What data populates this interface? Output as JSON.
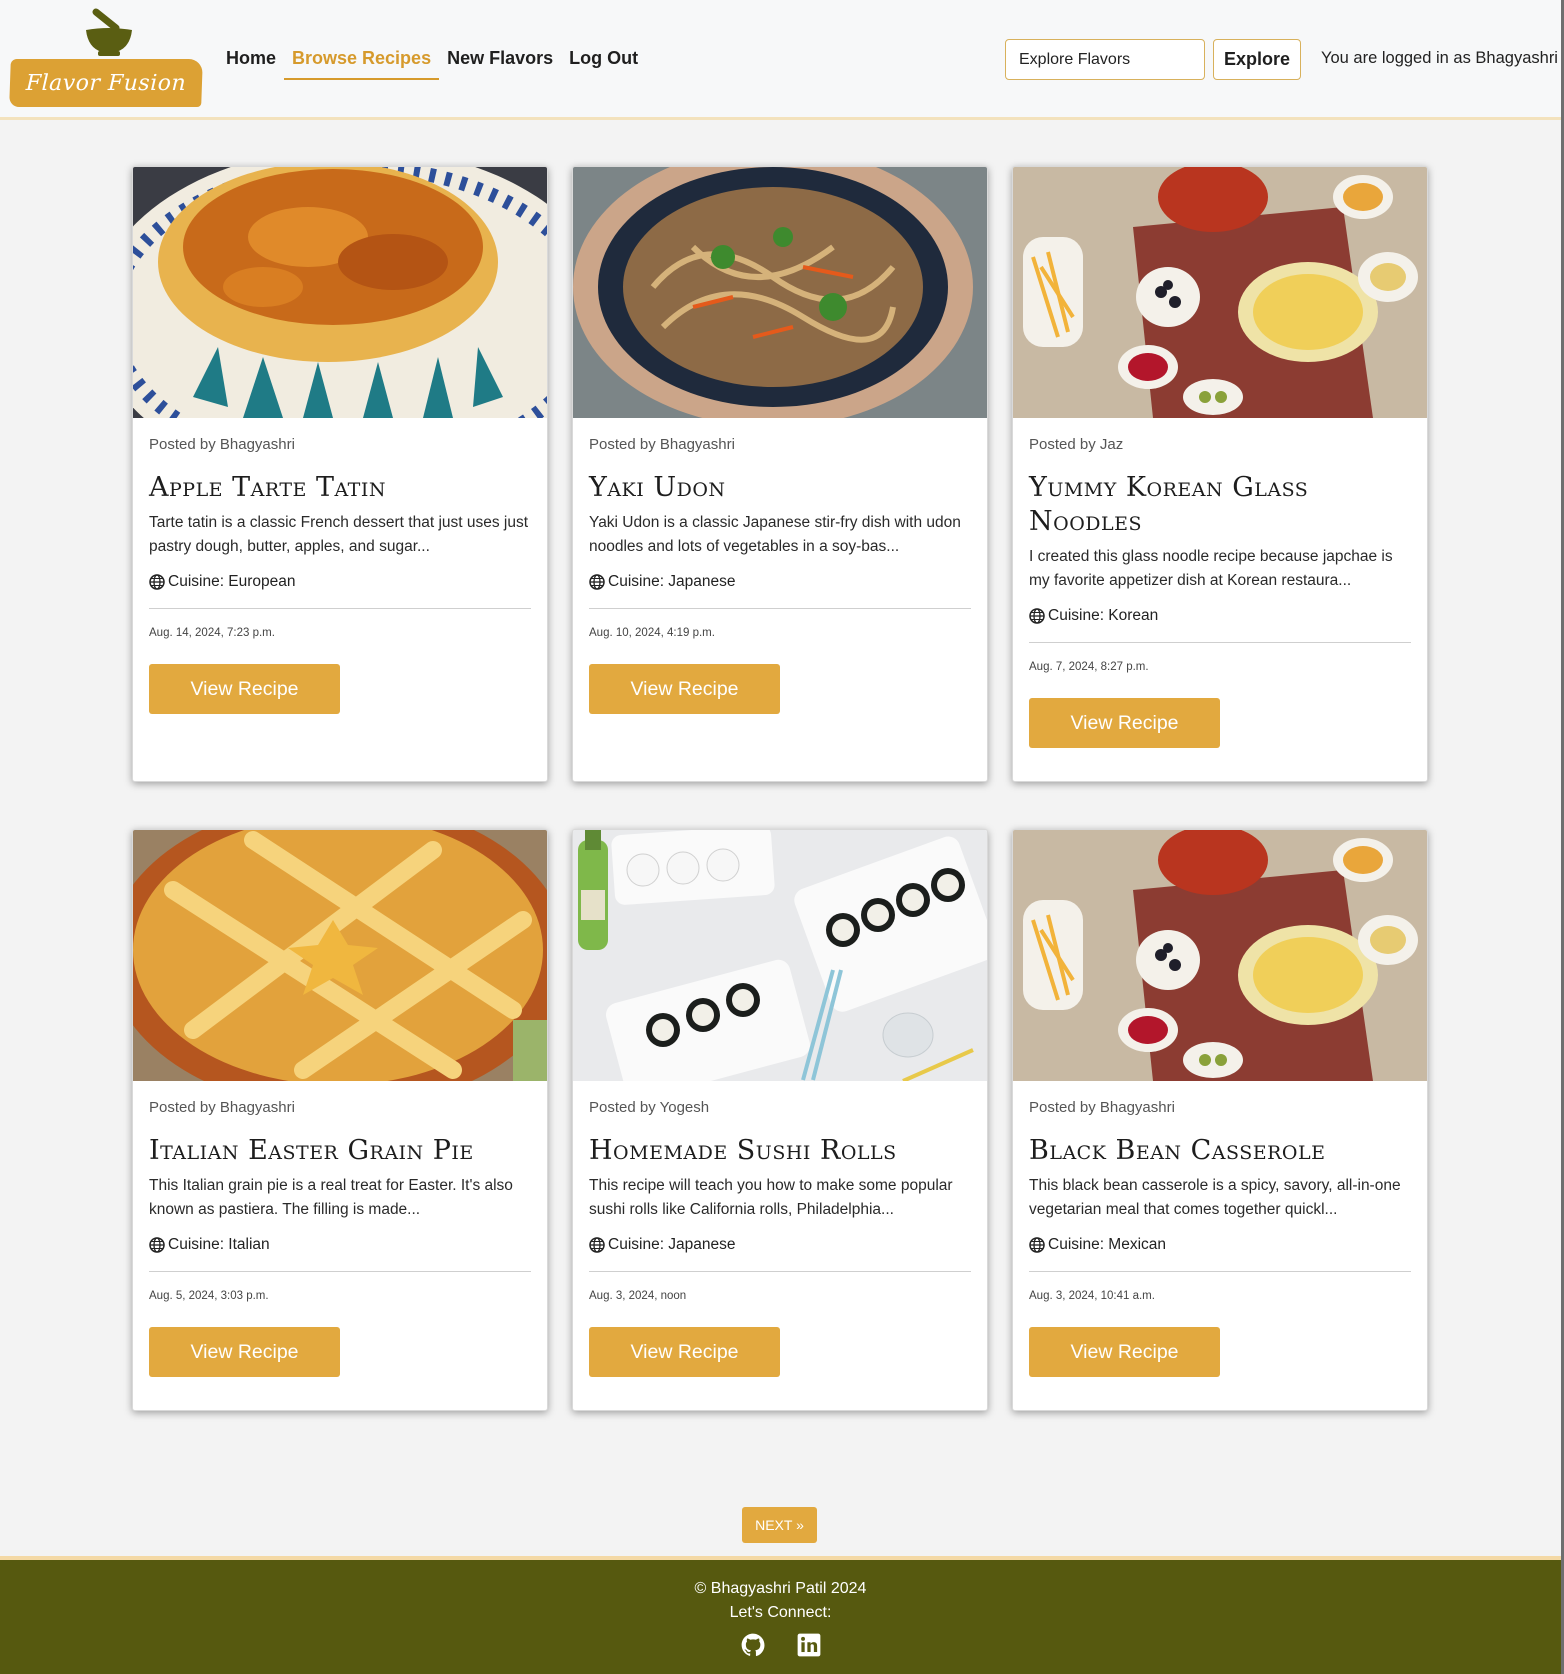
{
  "brand": {
    "name": "Flavor Fusion",
    "primary_color": "#e2a93f",
    "footer_color": "#56590f",
    "logo_icon": "mortar-pestle-icon"
  },
  "nav": {
    "home": "Home",
    "browse": "Browse Recipes",
    "new_flavors": "New Flavors",
    "logout": "Log Out",
    "active": "Browse Recipes"
  },
  "search": {
    "placeholder": "Explore Flavors",
    "button_label": "Explore"
  },
  "user": {
    "login_text": "You are logged in as Bhagyashri"
  },
  "recipes": [
    {
      "author": "Posted by Bhagyashri",
      "title": "Apple Tarte Tatin",
      "description": "Tarte tatin is a classic French dessert that just uses just pastry dough, butter, apples, and sugar...",
      "cuisine": "Cuisine: European",
      "date": "Aug. 14, 2024, 7:23 p.m.",
      "button": "View Recipe"
    },
    {
      "author": "Posted by Bhagyashri",
      "title": "Yaki Udon",
      "description": "Yaki Udon is a classic Japanese stir-fry dish with udon noodles and lots of vegetables in a soy-bas...",
      "cuisine": "Cuisine: Japanese",
      "date": "Aug. 10, 2024, 4:19 p.m.",
      "button": "View Recipe"
    },
    {
      "author": "Posted by Jaz",
      "title": "Yummy Korean Glass Noodles",
      "description": "I created this glass noodle recipe because japchae is my favorite appetizer dish at Korean restaura...",
      "cuisine": "Cuisine: Korean",
      "date": "Aug. 7, 2024, 8:27 p.m.",
      "button": "View Recipe"
    },
    {
      "author": "Posted by Bhagyashri",
      "title": "Italian Easter Grain Pie",
      "description": "This Italian grain pie is a real treat for Easter. It's also known as pastiera. The filling is made...",
      "cuisine": "Cuisine: Italian",
      "date": "Aug. 5, 2024, 3:03 p.m.",
      "button": "View Recipe"
    },
    {
      "author": "Posted by Yogesh",
      "title": "Homemade Sushi Rolls",
      "description": "This recipe will teach you how to make some popular sushi rolls like California rolls, Philadelphia...",
      "cuisine": "Cuisine: Japanese",
      "date": "Aug. 3, 2024, noon",
      "button": "View Recipe"
    },
    {
      "author": "Posted by Bhagyashri",
      "title": "Black Bean Casserole",
      "description": "This black bean casserole is a spicy, savory, all-in-one vegetarian meal that comes together quickl...",
      "cuisine": "Cuisine: Mexican",
      "date": "Aug. 3, 2024, 10:41 a.m.",
      "button": "View Recipe"
    }
  ],
  "pagination": {
    "next_label": "NEXT »"
  },
  "footer": {
    "copyright": "© Bhagyashri Patil 2024",
    "connect": "Let's Connect:",
    "icons": [
      "github-icon",
      "linkedin-icon"
    ]
  }
}
